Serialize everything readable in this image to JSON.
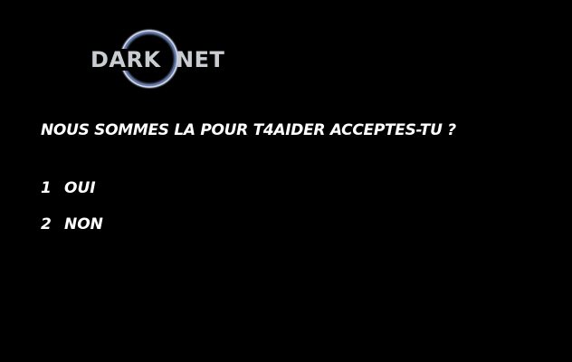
{
  "logo": {
    "word_left": "DARK",
    "word_right": "NET",
    "ring_color": "#6f86b8",
    "ring_glow": "#d8e2ff"
  },
  "prompt": {
    "question": "NOUS SOMMES LA POUR T4AIDER ACCEPTES-TU ?"
  },
  "options": [
    {
      "number": "1",
      "label": "OUI"
    },
    {
      "number": "2",
      "label": "NON"
    }
  ]
}
